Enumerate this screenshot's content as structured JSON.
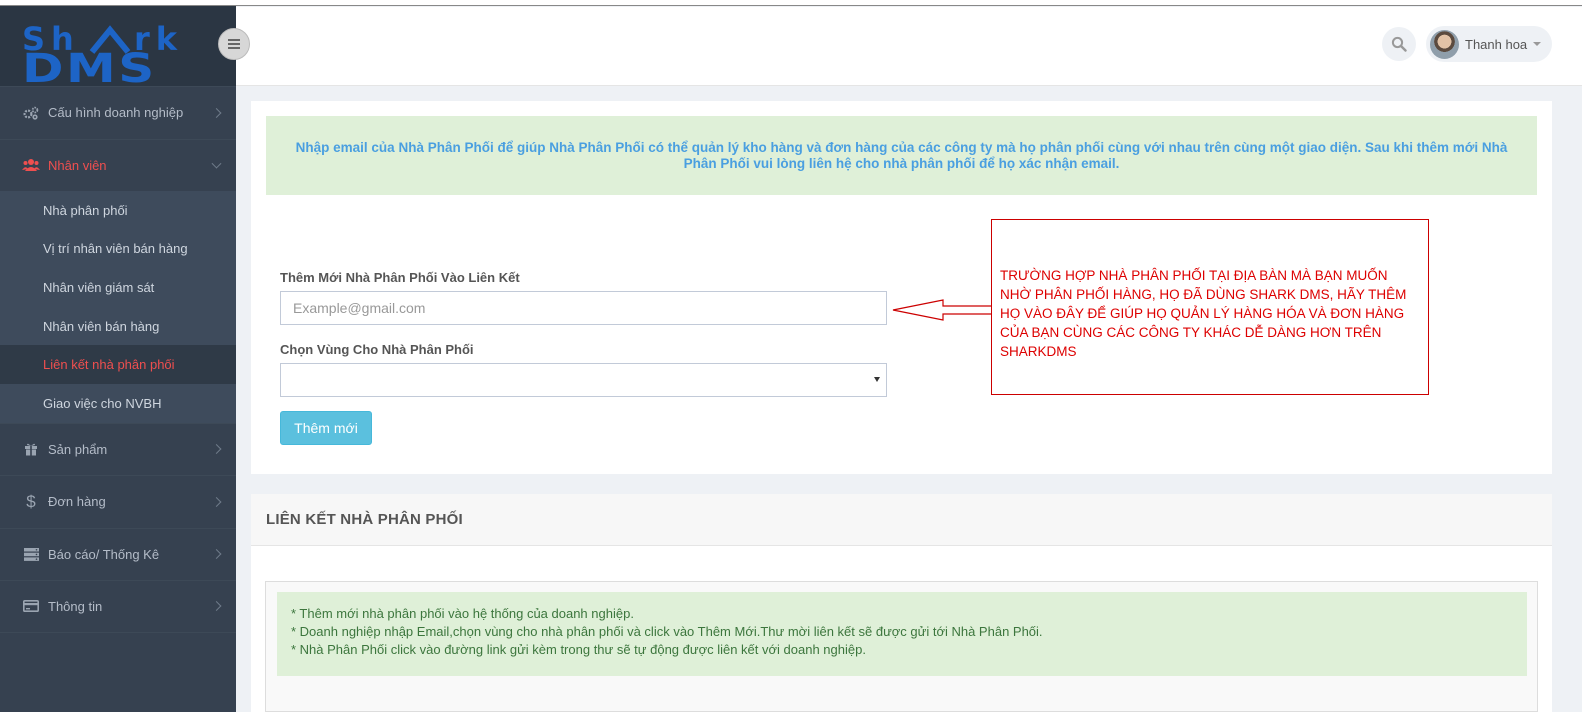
{
  "logo": {
    "line1": "SHARK",
    "line2": "DMS"
  },
  "header": {
    "user_name": "Thanh hoa"
  },
  "sidebar": {
    "items": [
      {
        "label": "Cấu hình doanh nghiệp",
        "icon": "cogs-icon"
      },
      {
        "label": "Nhân viên",
        "icon": "users-icon",
        "active": true
      },
      {
        "label": "Sản phẩm",
        "icon": "gift-icon"
      },
      {
        "label": "Đơn hàng",
        "icon": "dollar-icon"
      },
      {
        "label": "Báo cáo/ Thống Kê",
        "icon": "server-icon"
      },
      {
        "label": "Thông tin",
        "icon": "credit-card-icon"
      }
    ],
    "submenu": [
      {
        "label": "Nhà phân phối"
      },
      {
        "label": "Vị trí nhân viên bán hàng"
      },
      {
        "label": "Nhân viên giám sát"
      },
      {
        "label": "Nhân viên bán hàng"
      },
      {
        "label": "Liên kết nhà phân phối",
        "active": true
      },
      {
        "label": "Giao việc cho NVBH"
      }
    ]
  },
  "form": {
    "notice": "Nhập email của Nhà Phân Phối để giúp Nhà Phân Phối có thể quản lý kho hàng và đơn hàng của các công ty mà họ phân phối cùng với nhau trên cùng một giao diện. Sau khi thêm mới Nhà Phân Phối vui lòng liên hệ cho nhà phân phối để họ xác nhận email.",
    "email_label": "Thêm Mới Nhà Phân Phối Vào Liên Kết",
    "email_placeholder": "Example@gmail.com",
    "email_value": "",
    "region_label": "Chọn Vùng Cho Nhà Phân Phối",
    "region_value": "",
    "add_button": "Thêm mới"
  },
  "callout": {
    "text": "TRƯỜNG HỢP NHÀ PHÂN PHỐI TẠI ĐỊA BÀN MÀ BẠN MUỐN NHỜ PHÂN PHỐI HÀNG, HỌ ĐÃ DÙNG SHARK DMS, HÃY THÊM HỌ VÀO ĐÂY ĐỂ GIÚP HỌ QUẢN LÝ HÀNG HÓA VÀ ĐƠN HÀNG CỦA BẠN CÙNG CÁC CÔNG TY KHÁC DỄ DÀNG HƠN TRÊN SHARKDMS"
  },
  "links_panel": {
    "title": "LIÊN KẾT NHÀ PHÂN PHỐI",
    "notes": [
      "* Thêm mới nhà phân phối vào hệ thống của doanh nghiệp.",
      "* Doanh nghiệp nhập Email,chọn vùng cho nhà phân phối và click vào Thêm Mới.Thư mời liên kết sẽ được gửi tới Nhà Phân Phối.",
      "* Nhà Phân Phối click vào đường link gửi kèm trong thư sẽ tự động được liên kết với doanh nghiệp."
    ]
  },
  "colors": {
    "sidebar_bg": "#364150",
    "active_menu": "#ef4f4f",
    "notice_bg": "#dff0d8",
    "notice_text": "#4a9fe0",
    "button_bg": "#5bc0de",
    "logo_blue": "#1d64c6",
    "callout_red": "#dd0000"
  }
}
